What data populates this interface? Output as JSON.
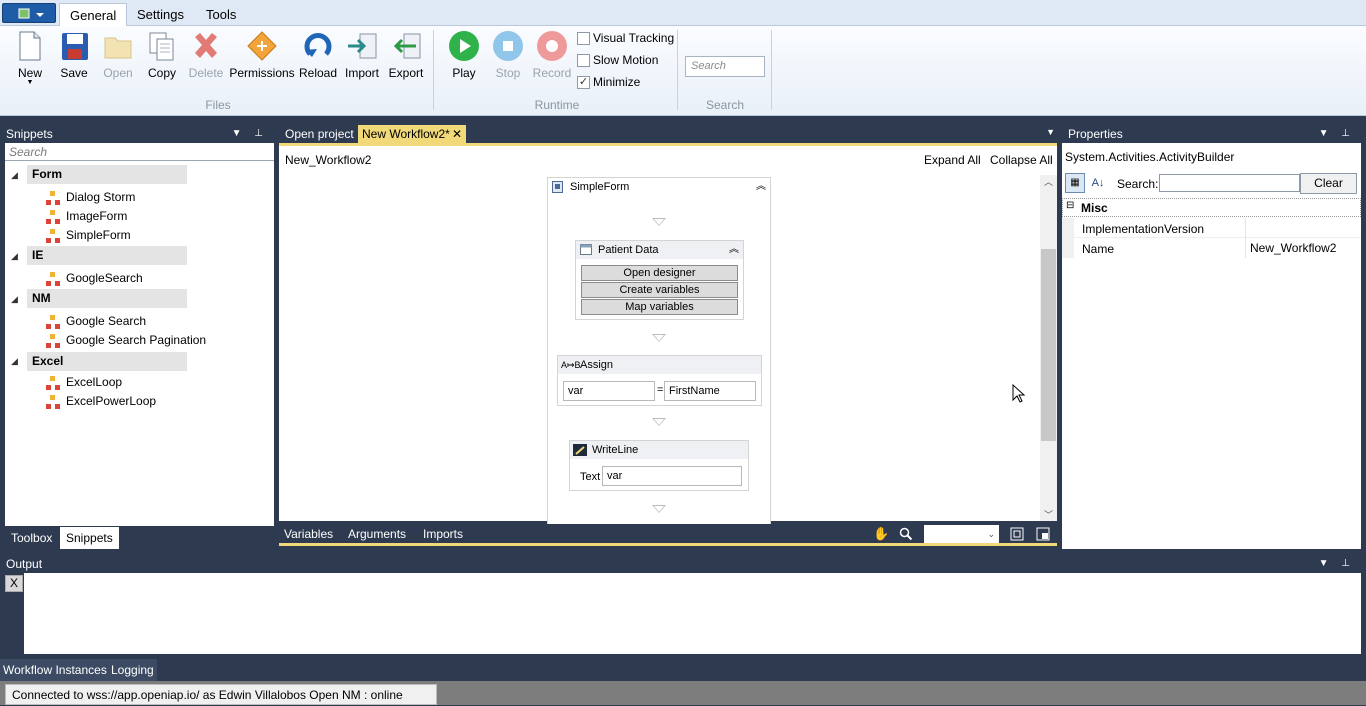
{
  "ribbon": {
    "tabs": [
      "General",
      "Settings",
      "Tools"
    ],
    "buttons": {
      "new": "New",
      "save": "Save",
      "open": "Open",
      "copy": "Copy",
      "delete": "Delete",
      "permissions": "Permissions",
      "reload": "Reload",
      "import": "Import",
      "export": "Export",
      "play": "Play",
      "stop": "Stop",
      "record": "Record"
    },
    "checkboxes": {
      "visual_tracking": "Visual Tracking",
      "slow_motion": "Slow Motion",
      "minimize": "Minimize",
      "minimize_checked": "✓"
    },
    "search_placeholder": "Search",
    "groups": {
      "files": "Files",
      "runtime": "Runtime",
      "search": "Search"
    }
  },
  "snippets": {
    "title": "Snippets",
    "search_placeholder": "Search",
    "categories": [
      {
        "name": "Form",
        "items": [
          "Dialog Storm",
          "ImageForm",
          "SimpleForm"
        ]
      },
      {
        "name": "IE",
        "items": [
          "GoogleSearch"
        ]
      },
      {
        "name": "NM",
        "items": [
          "Google Search",
          "Google Search Pagination"
        ]
      },
      {
        "name": "Excel",
        "items": [
          "ExcelLoop",
          "ExcelPowerLoop"
        ]
      }
    ],
    "bottom_tabs": [
      "Toolbox",
      "Snippets"
    ]
  },
  "designer": {
    "tabs": [
      "Open project",
      "New Workflow2*"
    ],
    "workflow_name": "New_Workflow2",
    "expand_all": "Expand All",
    "collapse_all": "Collapse All",
    "sequence_title": "SimpleForm",
    "form_activity": {
      "title": "Patient Data",
      "buttons": [
        "Open designer",
        "Create variables",
        "Map variables"
      ]
    },
    "assign": {
      "title": "Assign",
      "left": "var",
      "eq": "=",
      "right": "FirstName"
    },
    "writeline": {
      "title": "WriteLine",
      "label": "Text",
      "value": "var"
    },
    "footer_tabs": [
      "Variables",
      "Arguments",
      "Imports"
    ]
  },
  "properties": {
    "title": "Properties",
    "object_type": "System.Activities.ActivityBuilder",
    "search_label": "Search:",
    "clear_label": "Clear",
    "section": "Misc",
    "rows": [
      {
        "name": "ImplementationVersion",
        "value": ""
      },
      {
        "name": "Name",
        "value": "New_Workflow2"
      }
    ]
  },
  "output": {
    "title": "Output",
    "clear_label": "X"
  },
  "bottom_tabs": [
    "Workflow Instances",
    "Logging"
  ],
  "status": "Connected to wss://app.openiap.io/ as Edwin Villalobos  Open     NM : online",
  "colors": {
    "panel_header": "#2d3a4f",
    "active_tab": "#f1d97a",
    "ribbon_bg": "#e9f0f8"
  }
}
